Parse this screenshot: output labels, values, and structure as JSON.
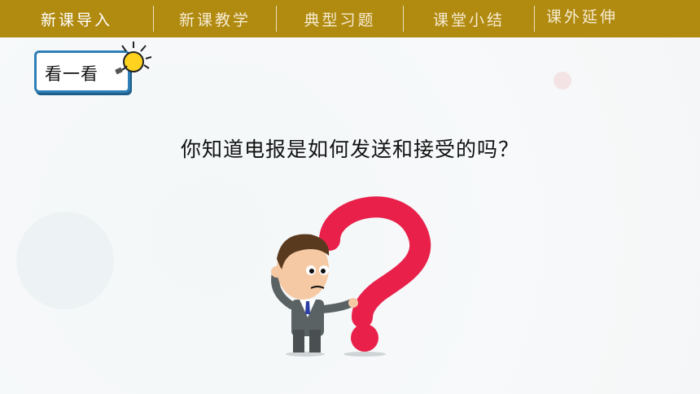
{
  "nav": {
    "items": [
      {
        "label": "新课导入"
      },
      {
        "label": "新课教学"
      },
      {
        "label": "典型习题"
      },
      {
        "label": "课堂小结"
      },
      {
        "label": "课外延伸"
      }
    ]
  },
  "badge": {
    "label": "看一看"
  },
  "question": "你知道电报是如何发送和接受的吗？",
  "colors": {
    "topbar": "#b18a10",
    "badge_border": "#2f7fb7",
    "question_mark": "#e8204a"
  },
  "icons": {
    "badge": "lightbulb-icon",
    "illustration": "thinking-man-question-mark"
  }
}
